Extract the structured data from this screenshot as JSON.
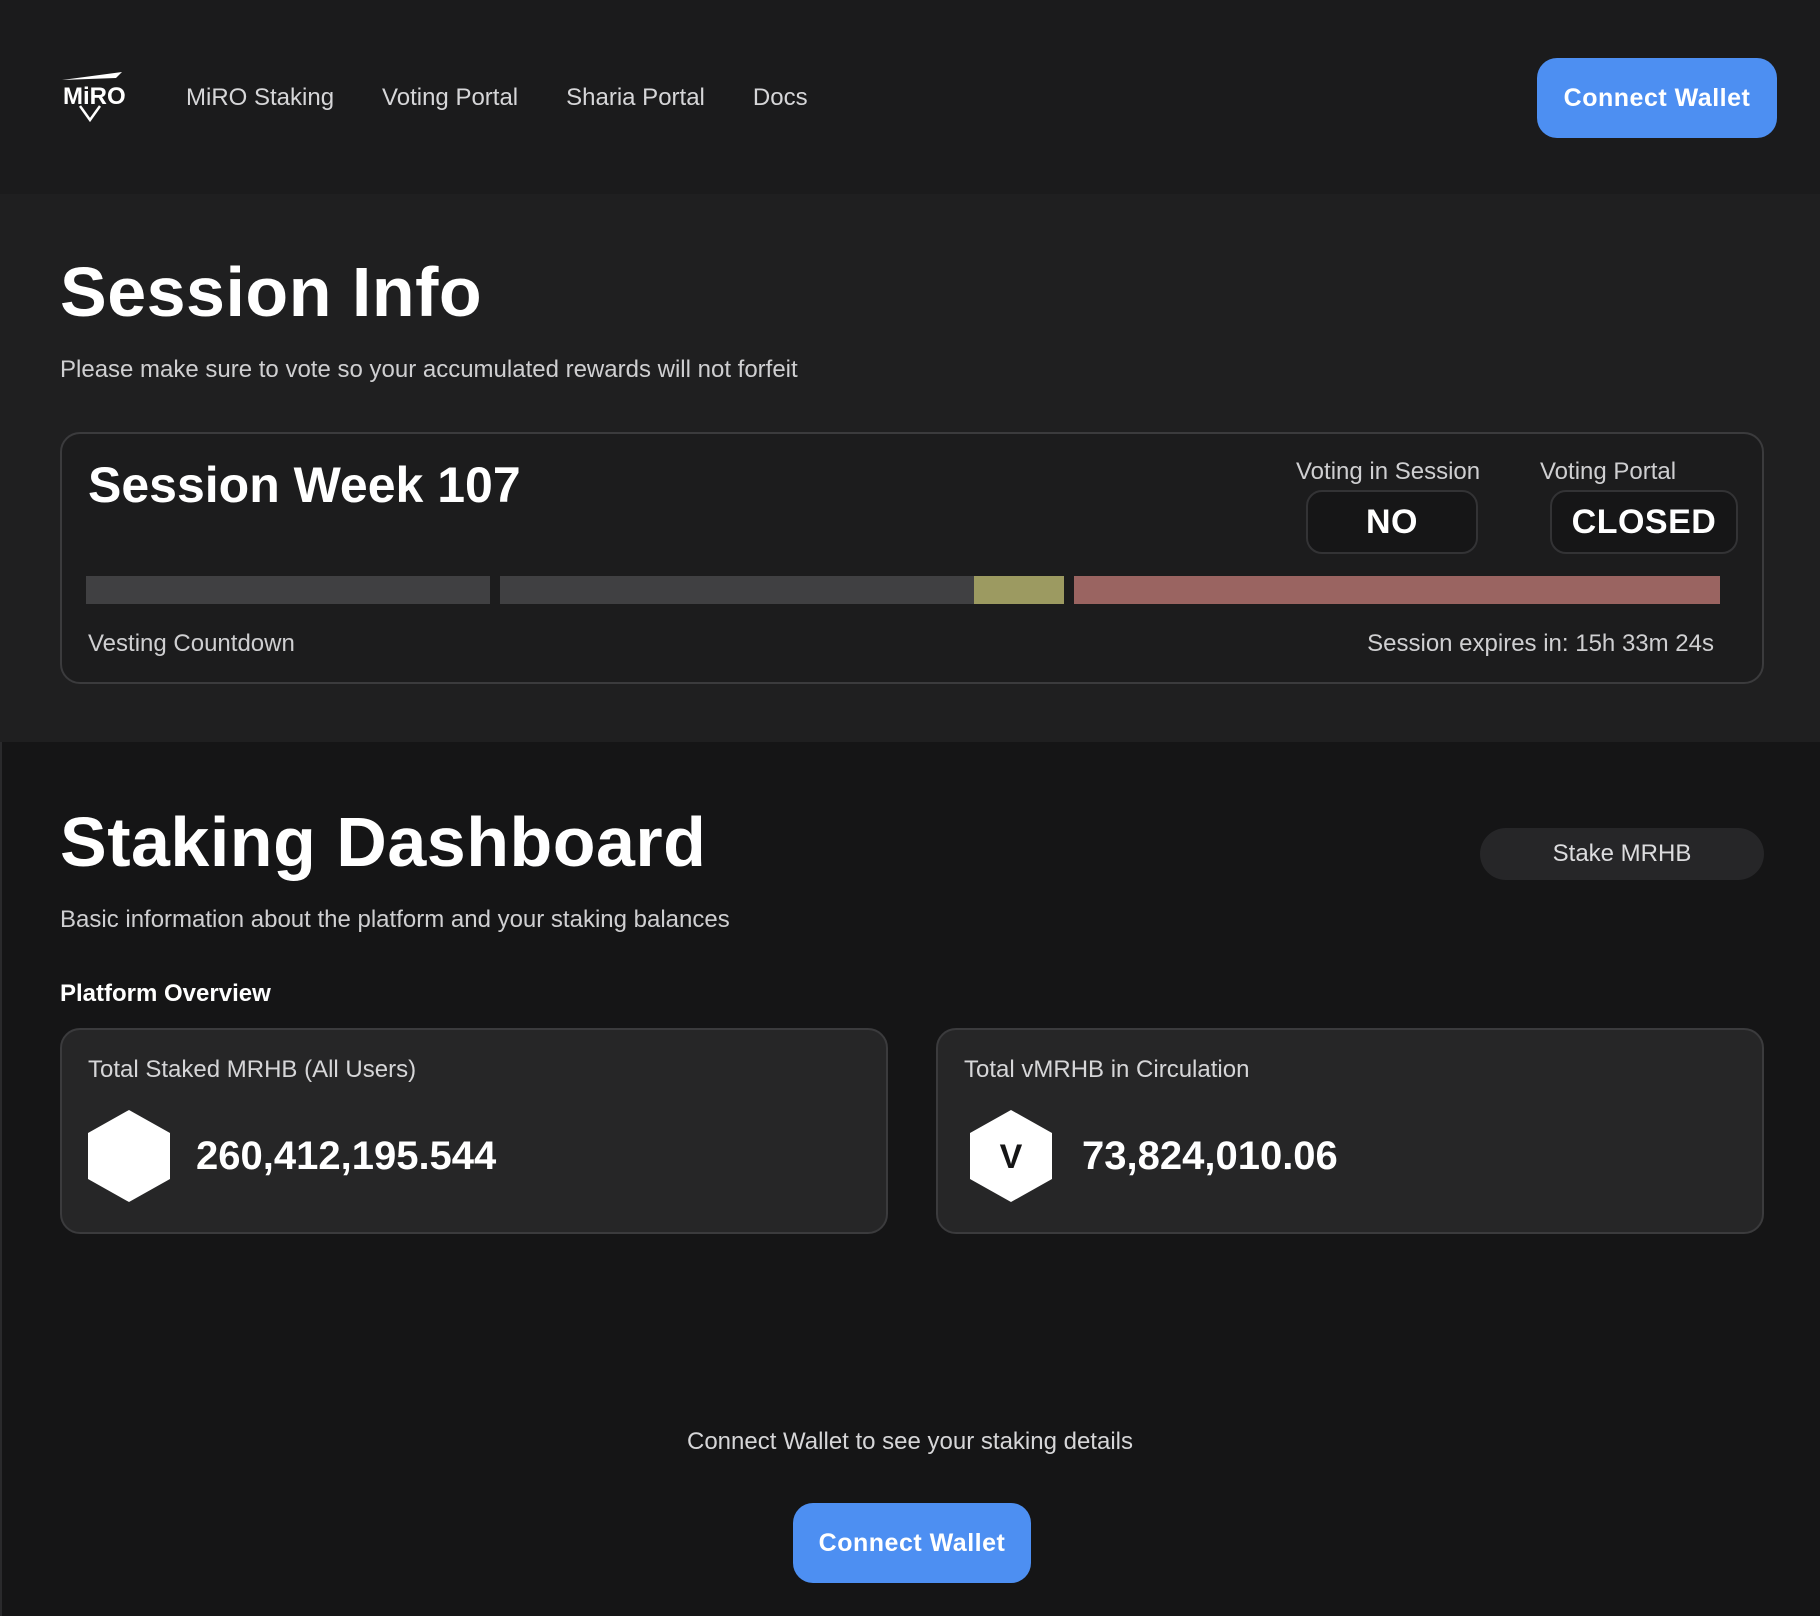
{
  "header": {
    "logo_icon": "miro-logo-icon",
    "nav": [
      {
        "label": "MiRO Staking"
      },
      {
        "label": "Voting Portal"
      },
      {
        "label": "Sharia Portal"
      },
      {
        "label": "Docs"
      }
    ],
    "connect_label": "Connect Wallet"
  },
  "session_info": {
    "title": "Session Info",
    "subtitle": "Please make sure to vote so your accumulated rewards will not forfeit",
    "card": {
      "week_label": "Session Week 107",
      "voting_in_session_label": "Voting in Session",
      "voting_in_session_value": "NO",
      "voting_portal_label": "Voting Portal",
      "voting_portal_value": "CLOSED",
      "vesting_label": "Vesting Countdown",
      "expires_label": "Session expires in: 15h 33m 24s",
      "progress_colors": {
        "empty": "#404042",
        "progress": "#9c9a61",
        "closed": "#9a6461"
      },
      "stage2_progress_fraction": 0.84
    }
  },
  "staking_dashboard": {
    "title": "Staking Dashboard",
    "subtitle": "Basic information about the platform and your staking balances",
    "stake_button_label": "Stake MRHB",
    "platform_overview_label": "Platform Overview",
    "stats": [
      {
        "title": "Total Staked MRHB (All Users)",
        "value": "260,412,195.544",
        "icon": "mrhb-hexagon-icon"
      },
      {
        "title": "Total vMRHB in Circulation",
        "value": "73,824,010.06",
        "icon": "vmrhb-hexagon-icon",
        "icon_letter": "V"
      }
    ],
    "connect_prompt": "Connect Wallet to see your staking details",
    "connect_label": "Connect Wallet"
  },
  "colors": {
    "accent": "#4d8ff2"
  }
}
